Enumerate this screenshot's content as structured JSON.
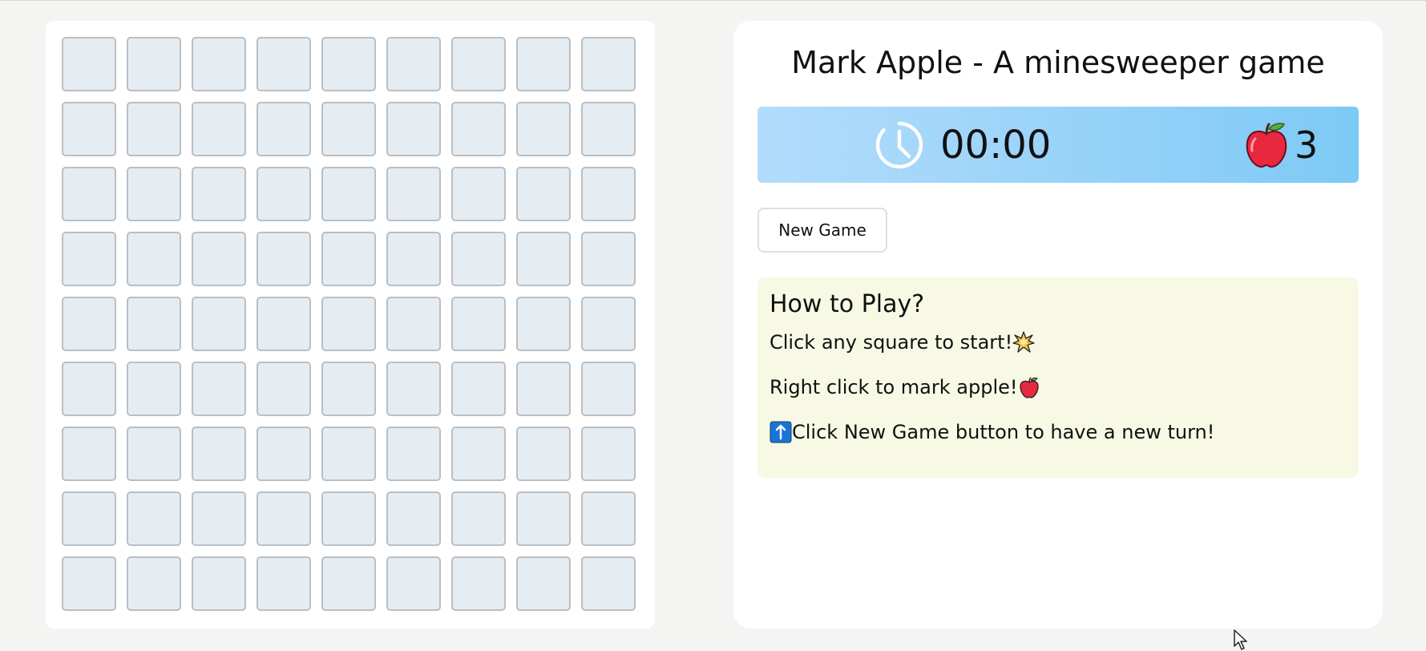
{
  "header": {
    "title": "Mark Apple - A minesweeper game"
  },
  "status": {
    "timer": "00:00",
    "timer_icon": "clock-icon",
    "apple_icon": "apple-icon",
    "apples_remaining": "3"
  },
  "controls": {
    "new_game_label": "New Game"
  },
  "board": {
    "rows": 9,
    "columns": 9,
    "cell_color": "#e5edf2",
    "cell_border_color": "#b9bfc5"
  },
  "how_to_play": {
    "heading": "How to Play?",
    "line_1": "Click any square to start!",
    "line_1_icon": "collision-icon",
    "line_2": "Right click to mark apple!",
    "line_2_icon": "apple-icon",
    "line_3": "Click New Game button to have a new turn!",
    "line_3_icon": "up-arrow-icon"
  },
  "colors": {
    "page_background": "#f4f4f3",
    "status_bar_start": "#b2dcfc",
    "status_bar_end": "#7ccaf6",
    "howto_background": "#f7f9e4"
  }
}
